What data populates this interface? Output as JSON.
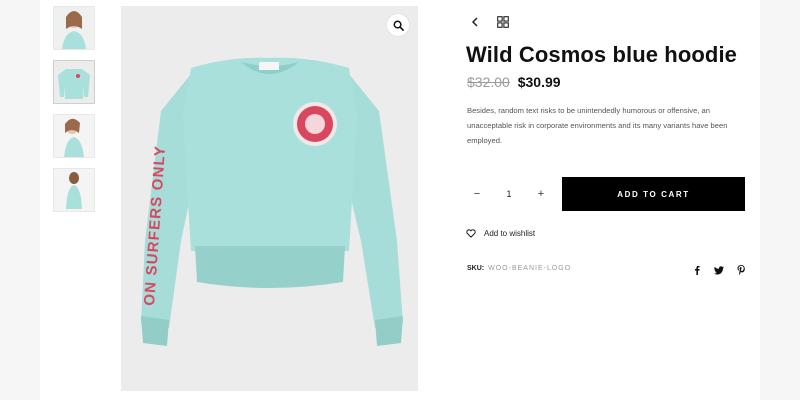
{
  "product": {
    "title": "Wild Cosmos blue hoodie",
    "price_old": "$32.00",
    "price_new": "$30.99",
    "description": "Besides, random text risks to be unintendedly humorous or offensive, an unacceptable risk in corporate environments and its many variants have been employed."
  },
  "purchase": {
    "qty_minus": "−",
    "qty_value": "1",
    "qty_plus": "+",
    "add_to_cart_label": "ADD TO CART"
  },
  "wishlist": {
    "label": "Add to wishlist"
  },
  "meta": {
    "sku_label": "SKU:",
    "sku_value": "WOO-BEANIE-LOGO"
  },
  "icons": {
    "zoom": "search-icon",
    "back": "chevron-left-icon",
    "grid": "grid-icon",
    "wishlist": "heart-icon",
    "social": [
      "facebook-icon",
      "twitter-icon",
      "pinterest-icon"
    ]
  },
  "colors": {
    "hoodie": "#a9e0dc",
    "hoodie_shadow": "#8fcfca",
    "print_red": "#d9475f",
    "button_bg": "#000000",
    "image_bg": "#ececec"
  }
}
